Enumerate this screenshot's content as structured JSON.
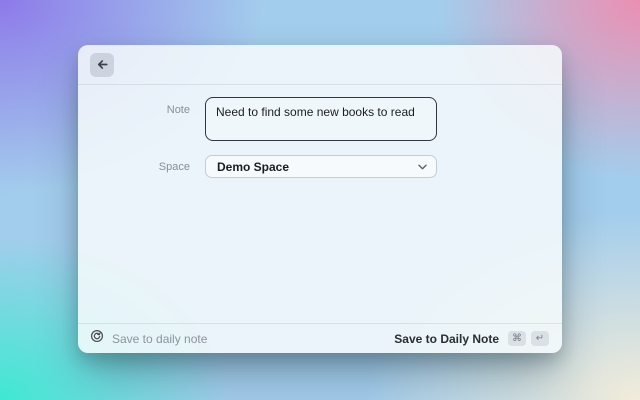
{
  "background": {
    "corner_colors": {
      "top_left": "#8d7ae9",
      "top_right": "#ec8fb2",
      "bottom_left": "#3fe8d2",
      "bottom_right": "#f2ecd9",
      "center": "#a3cdec"
    }
  },
  "window": {
    "form": {
      "note": {
        "label": "Note",
        "value": "Need to find some new books to read"
      },
      "space": {
        "label": "Space",
        "value": "Demo Space"
      }
    },
    "footer": {
      "secondary_action": "Save to daily note",
      "primary_action": "Save to Daily Note",
      "shortcut_keys": [
        "⌘",
        "↵"
      ]
    }
  }
}
